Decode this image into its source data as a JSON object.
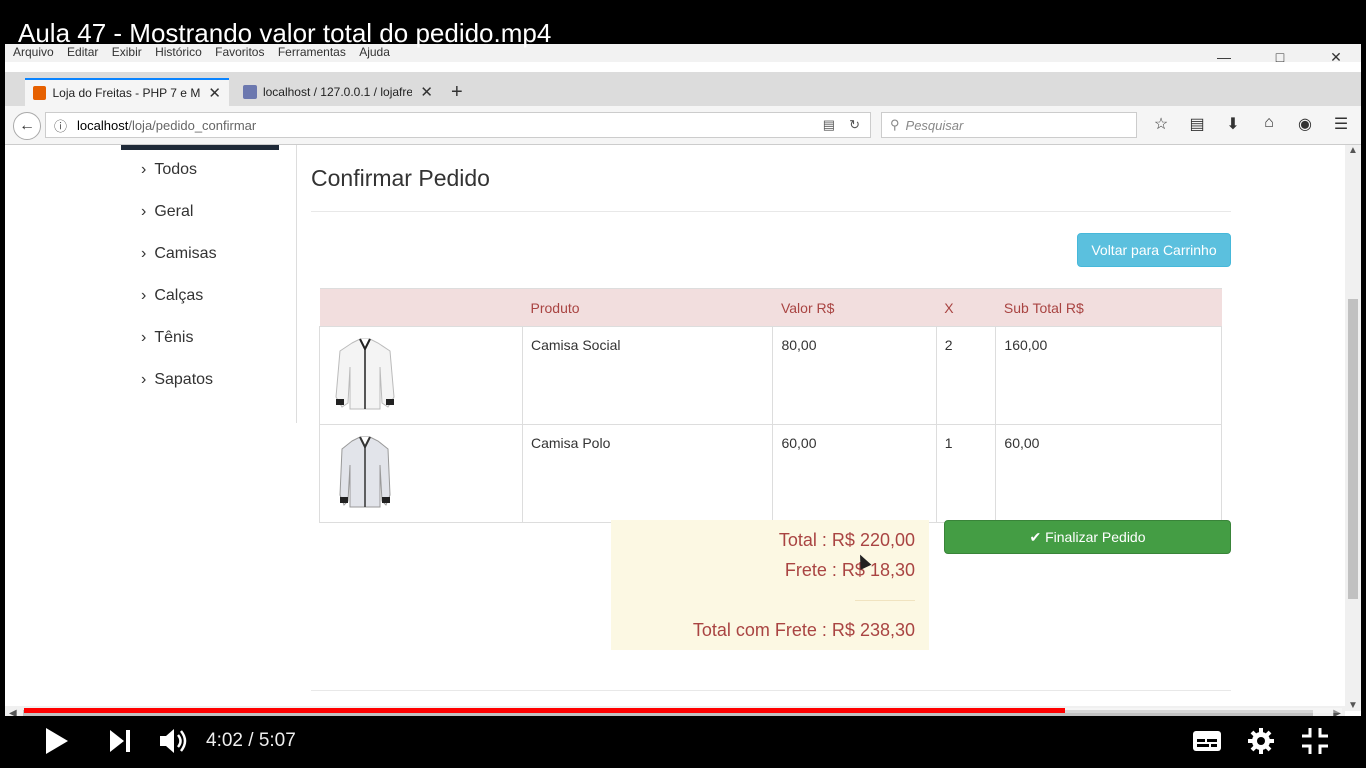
{
  "video": {
    "title": "Aula 47 - Mostrando valor total do pedido.mp4",
    "time_display": "4:02 / 5:07",
    "progress_fraction": 0.79
  },
  "browser": {
    "menu": [
      "Arquivo",
      "Editar",
      "Exibir",
      "Histórico",
      "Favoritos",
      "Ferramentas",
      "Ajuda"
    ],
    "tabs": [
      {
        "label": "Loja do Freitas - PHP 7 e My",
        "favicon_color": "#e66000"
      },
      {
        "label": "localhost / 127.0.0.1 / lojafre",
        "favicon_color": "#6c78af"
      }
    ],
    "url_host": "localhost",
    "url_path": "/loja/pedido_confirmar",
    "search_placeholder": "Pesquisar"
  },
  "sidebar": {
    "items": [
      "Todos",
      "Geral",
      "Camisas",
      "Calças",
      "Tênis",
      "Sapatos"
    ]
  },
  "page": {
    "title": "Confirmar Pedido",
    "back_button": "Voltar para Carrinho",
    "finish_button": "Finalizar Pedido"
  },
  "cart": {
    "headers": [
      "",
      "Produto",
      "Valor R$",
      "X",
      "Sub Total R$"
    ],
    "rows": [
      {
        "product": "Camisa Social",
        "price": "80,00",
        "qty": "2",
        "subtotal": "160,00"
      },
      {
        "product": "Camisa Polo",
        "price": "60,00",
        "qty": "1",
        "subtotal": "60,00"
      }
    ]
  },
  "totals": {
    "total": "Total : R$ 220,00",
    "frete": "Frete : R$ 18,30",
    "total_frete": "Total com Frete : R$ 238,30"
  },
  "colors": {
    "header_bg": "#f2dede",
    "header_text": "#a94442",
    "btn_info": "#5bc0de",
    "btn_success": "#449d44",
    "totals_bg": "#fcf8e3"
  }
}
